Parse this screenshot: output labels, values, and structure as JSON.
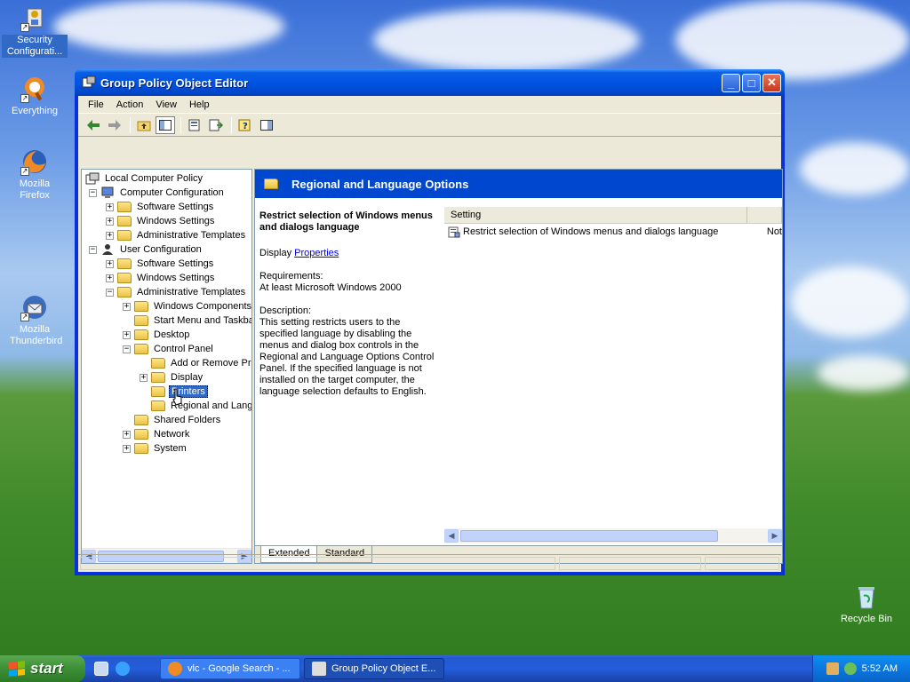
{
  "desktop": {
    "icons": [
      {
        "label": "Security Configurati..."
      },
      {
        "label": "Everything"
      },
      {
        "label": "Mozilla Firefox"
      },
      {
        "label": "Mozilla Thunderbird"
      },
      {
        "label": "Recycle Bin"
      }
    ]
  },
  "window": {
    "title": "Group Policy Object Editor",
    "menu": [
      "File",
      "Action",
      "View",
      "Help"
    ],
    "tree": [
      {
        "label": "Local Computer Policy"
      },
      {
        "label": "Computer Configuration"
      },
      {
        "label": "Software Settings"
      },
      {
        "label": "Windows Settings"
      },
      {
        "label": "Administrative Templates"
      },
      {
        "label": "User Configuration"
      },
      {
        "label": "Software Settings"
      },
      {
        "label": "Windows Settings"
      },
      {
        "label": "Administrative Templates"
      },
      {
        "label": "Windows Components"
      },
      {
        "label": "Start Menu and Taskba"
      },
      {
        "label": "Desktop"
      },
      {
        "label": "Control Panel"
      },
      {
        "label": "Add or Remove Pro"
      },
      {
        "label": "Display"
      },
      {
        "label": "Printers"
      },
      {
        "label": "Regional and Langu"
      },
      {
        "label": "Shared Folders"
      },
      {
        "label": "Network"
      },
      {
        "label": "System"
      }
    ],
    "right": {
      "header": "Regional and Language Options",
      "desc_title": "Restrict selection of Windows menus and dialogs language",
      "display_prefix": "Display",
      "display_link": "Properties",
      "requirements_label": "Requirements:",
      "requirements": "At least Microsoft Windows 2000",
      "description_label": "Description:",
      "description": "This setting restricts users to the specified language by disabling the menus and dialog box controls in the Regional and Language Options Control Panel. If the specified language is not installed on the target computer, the language selection defaults to English.",
      "column_setting": "Setting",
      "rows": [
        {
          "setting": "Restrict selection of Windows menus and dialogs language",
          "state": "Not"
        }
      ],
      "tabs": [
        "Extended",
        "Standard"
      ]
    }
  },
  "taskbar": {
    "start": "start",
    "tasks": [
      {
        "label": "vlc - Google Search - ..."
      },
      {
        "label": "Group Policy Object E..."
      }
    ],
    "clock": "5:52 AM"
  }
}
